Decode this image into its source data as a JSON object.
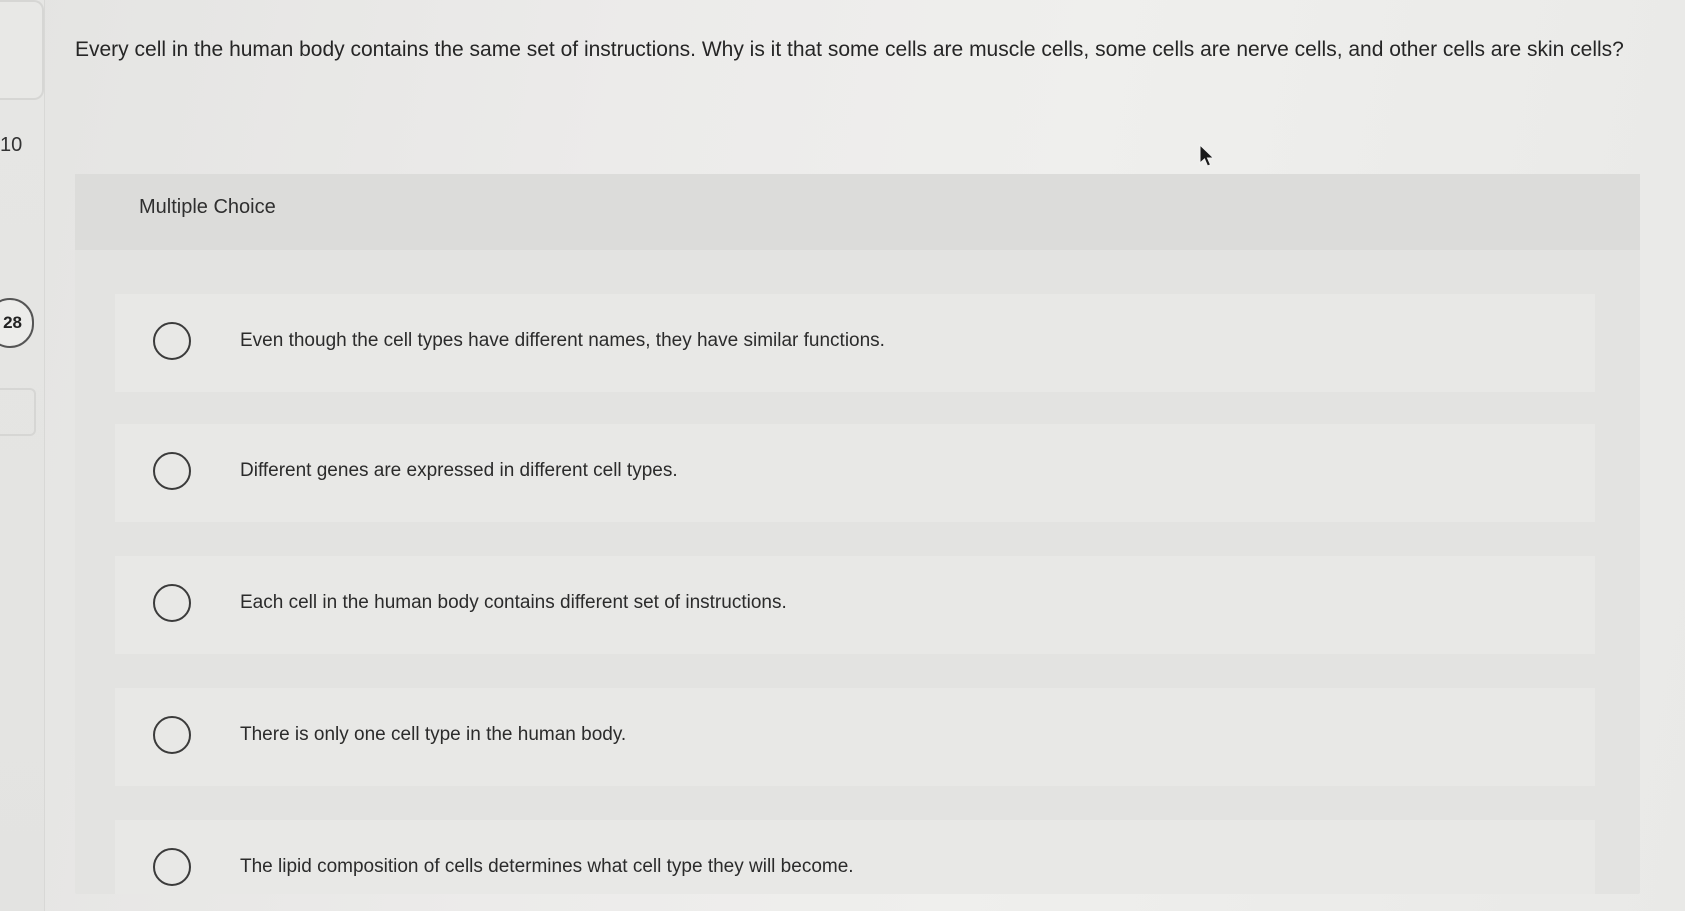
{
  "sidebar": {
    "question_number": "10",
    "score_badge": "28"
  },
  "question": {
    "text": "Every cell in the human body contains the same set of instructions. Why is it that some cells are muscle cells, some cells are nerve cells, and other cells are skin cells?"
  },
  "answer_panel": {
    "title": "Multiple Choice",
    "options": [
      {
        "label": "Even though the cell types have different names, they have similar functions."
      },
      {
        "label": "Different genes are expressed in different cell types."
      },
      {
        "label": "Each cell in the human body contains different set of instructions."
      },
      {
        "label": "There is only one cell type in the human body."
      },
      {
        "label": "The lipid composition of cells determines what cell type they will become."
      }
    ]
  }
}
